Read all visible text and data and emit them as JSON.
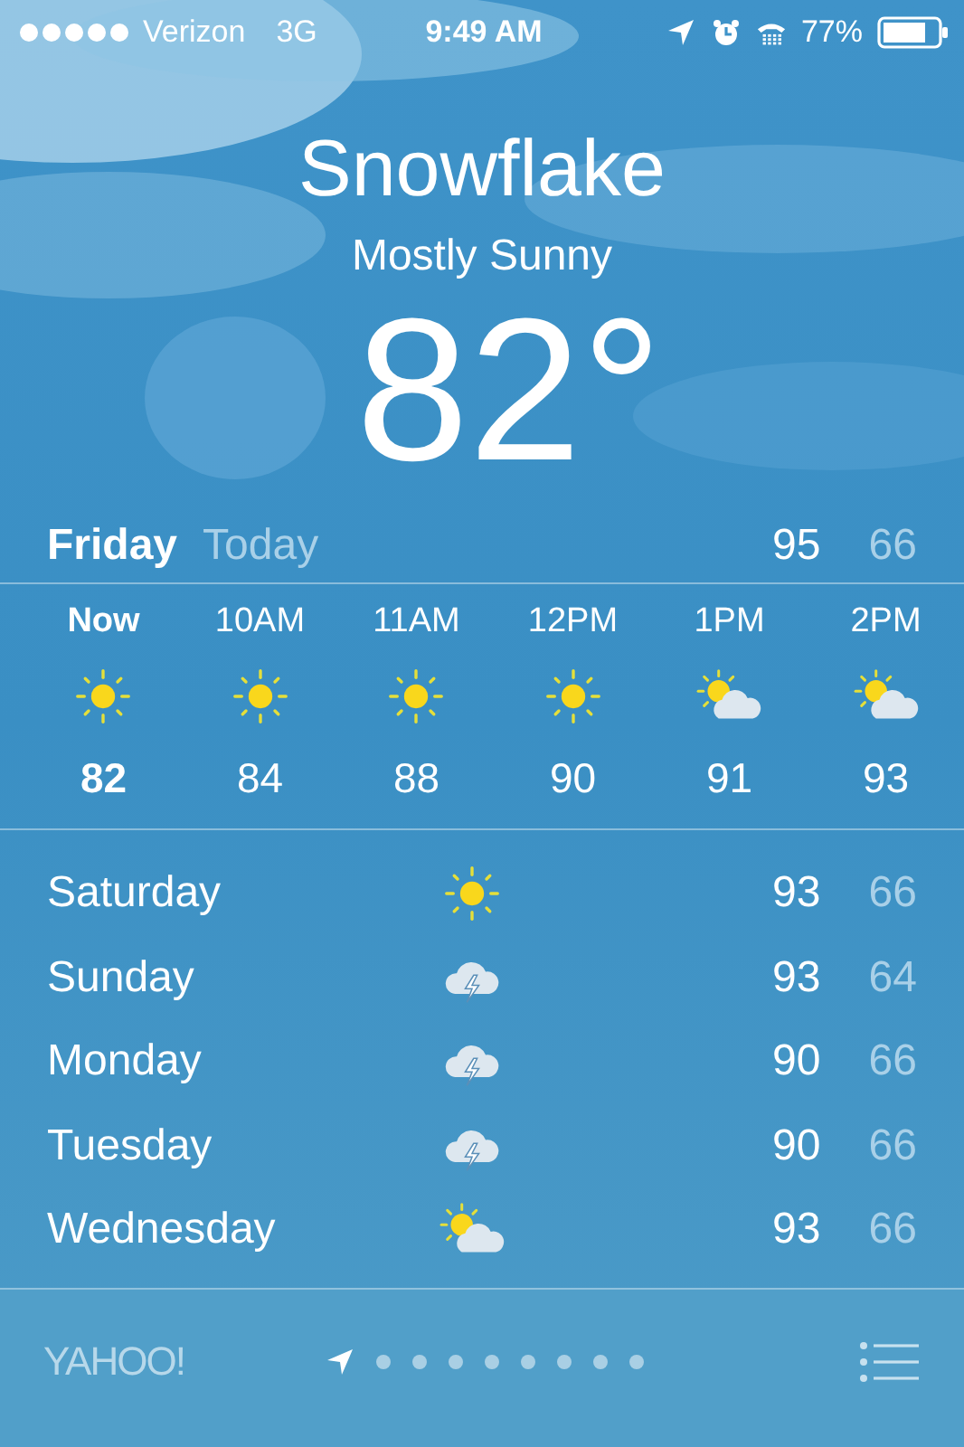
{
  "status_bar": {
    "carrier": "Verizon",
    "network": "3G",
    "time": "9:49 AM",
    "battery": "77%"
  },
  "location": "Snowflake",
  "condition": "Mostly Sunny",
  "temperature": "82°",
  "today": {
    "day": "Friday",
    "label": "Today",
    "high": "95",
    "low": "66"
  },
  "hourly": [
    {
      "time": "Now",
      "kind": "sunny",
      "temp": "82",
      "selected": true
    },
    {
      "time": "10AM",
      "kind": "sunny",
      "temp": "84",
      "selected": false
    },
    {
      "time": "11AM",
      "kind": "sunny",
      "temp": "88",
      "selected": false
    },
    {
      "time": "12PM",
      "kind": "sunny",
      "temp": "90",
      "selected": false
    },
    {
      "time": "1PM",
      "kind": "partly-cloudy",
      "temp": "91",
      "selected": false
    },
    {
      "time": "2PM",
      "kind": "partly-cloudy",
      "temp": "93",
      "selected": false
    }
  ],
  "daily": [
    {
      "day": "Saturday",
      "kind": "sunny",
      "high": "93",
      "low": "66"
    },
    {
      "day": "Sunday",
      "kind": "thunderstorm",
      "high": "93",
      "low": "64"
    },
    {
      "day": "Monday",
      "kind": "thunderstorm",
      "high": "90",
      "low": "66"
    },
    {
      "day": "Tuesday",
      "kind": "thunderstorm",
      "high": "90",
      "low": "66"
    },
    {
      "day": "Wednesday",
      "kind": "partly-cloudy",
      "high": "93",
      "low": "66"
    }
  ],
  "footer": {
    "logo": "YAHOO!",
    "pages": [
      {
        "kind": "location",
        "selected": true
      },
      {
        "kind": "dot",
        "selected": false
      },
      {
        "kind": "dot",
        "selected": false
      },
      {
        "kind": "dot",
        "selected": false
      },
      {
        "kind": "dot",
        "selected": false
      },
      {
        "kind": "dot",
        "selected": false
      },
      {
        "kind": "dot",
        "selected": false
      },
      {
        "kind": "dot",
        "selected": false
      },
      {
        "kind": "dot",
        "selected": false
      }
    ]
  }
}
